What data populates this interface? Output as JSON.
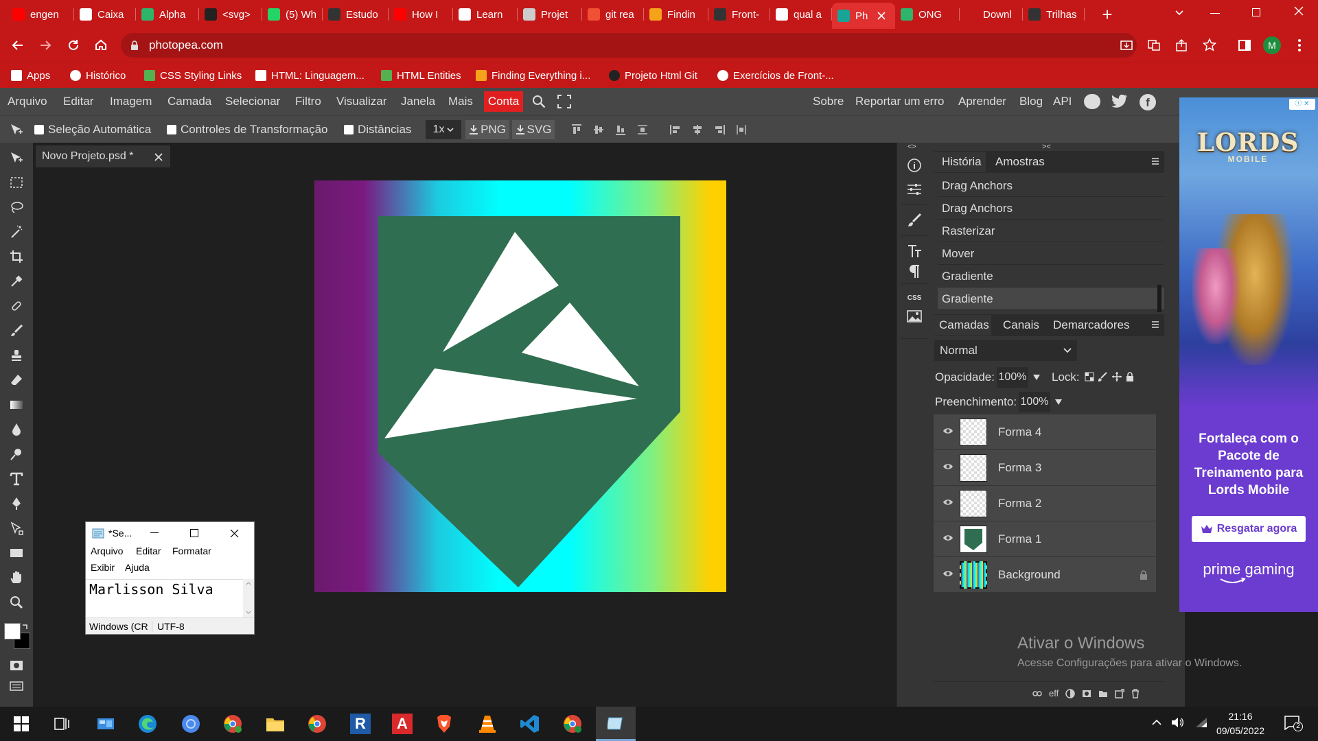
{
  "browser": {
    "tabs": [
      {
        "title": "engen",
        "icon": "youtube-icon"
      },
      {
        "title": "Caixa",
        "icon": "gmail-icon"
      },
      {
        "title": "Alpha",
        "icon": "alpha-icon"
      },
      {
        "title": "<svg>",
        "icon": "m-icon"
      },
      {
        "title": "(5) Wh",
        "icon": "whatsapp-icon"
      },
      {
        "title": "Estudo",
        "icon": "github-icon"
      },
      {
        "title": "How I",
        "icon": "youtube-icon"
      },
      {
        "title": "Learn",
        "icon": "globe-icon"
      },
      {
        "title": "Projet",
        "icon": "window-icon"
      },
      {
        "title": "git rea",
        "icon": "git-icon"
      },
      {
        "title": "Findin",
        "icon": "li-icon"
      },
      {
        "title": "Front-",
        "icon": "github-icon"
      },
      {
        "title": "qual a",
        "icon": "google-icon"
      },
      {
        "title": "Ph",
        "icon": "photopea-icon"
      },
      {
        "title": "ONG",
        "icon": "alpha-icon"
      },
      {
        "title": "Downl",
        "icon": "download-icon"
      },
      {
        "title": "Trilhas",
        "icon": "github-icon"
      }
    ],
    "new_tab": "+",
    "url": "photopea.com",
    "profile_initial": "M",
    "bookmarks": [
      {
        "label": "Apps",
        "icon": "apps-grid-icon"
      },
      {
        "label": "Histórico",
        "icon": "history-icon"
      },
      {
        "label": "CSS Styling Links",
        "icon": "w-icon"
      },
      {
        "label": "HTML: Linguagem...",
        "icon": "m-icon"
      },
      {
        "label": "HTML Entities",
        "icon": "w-icon"
      },
      {
        "label": "Finding Everything i...",
        "icon": "li-icon"
      },
      {
        "label": "Projeto Html Git",
        "icon": "github-icon"
      },
      {
        "label": "Exercícios de Front-...",
        "icon": "globe-icon"
      }
    ]
  },
  "photopea": {
    "menu": [
      "Arquivo",
      "Editar",
      "Imagem",
      "Camada",
      "Selecionar",
      "Filtro",
      "Visualizar",
      "Janela",
      "Mais"
    ],
    "account": "Conta",
    "right_menu": [
      "Sobre",
      "Reportar um erro",
      "Aprender",
      "Blog",
      "API"
    ],
    "options": {
      "auto_select": "Seleção Automática",
      "transform_controls": "Controles de Transformação",
      "distances": "Distâncias",
      "zoom": "1x",
      "png": "PNG",
      "svg": "SVG"
    },
    "document_tab": "Novo Projeto.psd *",
    "css_label": "CSS",
    "history_tabs": [
      "História",
      "Amostras"
    ],
    "history": [
      "Drag Anchors",
      "Drag Anchors",
      "Rasterizar",
      "Mover",
      "Gradiente",
      "Gradiente"
    ],
    "layer_tabs": [
      "Camadas",
      "Canais",
      "Demarcadores"
    ],
    "blend_mode": "Normal",
    "opacity_label": "Opacidade:",
    "opacity": "100%",
    "lock_label": "Lock:",
    "fill_label": "Preenchimento:",
    "fill": "100%",
    "layers": [
      "Forma 4",
      "Forma 3",
      "Forma 2",
      "Forma 1",
      "Background"
    ],
    "layer_bottom_eff": "eff",
    "colors": {
      "canvas_green": "#2f6e50",
      "brand_red": "#c41818"
    }
  },
  "ad": {
    "brand": "LORDS",
    "brand_sub": "MOBILE",
    "text": "Fortaleça com o Pacote de Treinamento para Lords Mobile",
    "button": "Resgatar agora",
    "footer": "prime gaming"
  },
  "activation": {
    "title": "Ativar o Windows",
    "subtitle": "Acesse Configurações para ativar o Windows."
  },
  "notepad": {
    "title": "*Se...",
    "menu": [
      "Arquivo",
      "Editar",
      "Formatar",
      "Exibir",
      "Ajuda"
    ],
    "content": "Marlisson Silva",
    "status_encoding_line": "Windows (CR",
    "status_charset": "UTF-8"
  },
  "taskbar": {
    "time": "21:16",
    "date": "09/05/2022",
    "notification_count": "2"
  }
}
